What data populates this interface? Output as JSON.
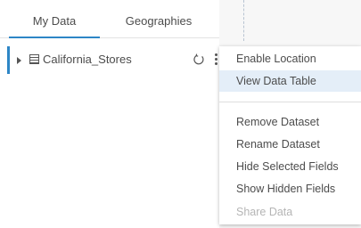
{
  "tabs": [
    {
      "label": "My Data"
    },
    {
      "label": "Geographies"
    }
  ],
  "dataset": {
    "name": "California_Stores"
  },
  "context_menu": {
    "items": [
      {
        "label": "Enable Location"
      },
      {
        "label": "View Data Table"
      },
      {
        "label": "Remove Dataset"
      },
      {
        "label": "Rename Dataset"
      },
      {
        "label": "Hide Selected Fields"
      },
      {
        "label": "Show Hidden Fields"
      },
      {
        "label": "Share Data"
      }
    ]
  },
  "colors": {
    "accent": "#2d86c6",
    "highlight": "#e4eef8",
    "disabled_text": "#b5b5b5"
  },
  "icons": [
    "expand-caret-icon",
    "table-icon",
    "refresh-icon",
    "kebab-menu-icon"
  ]
}
